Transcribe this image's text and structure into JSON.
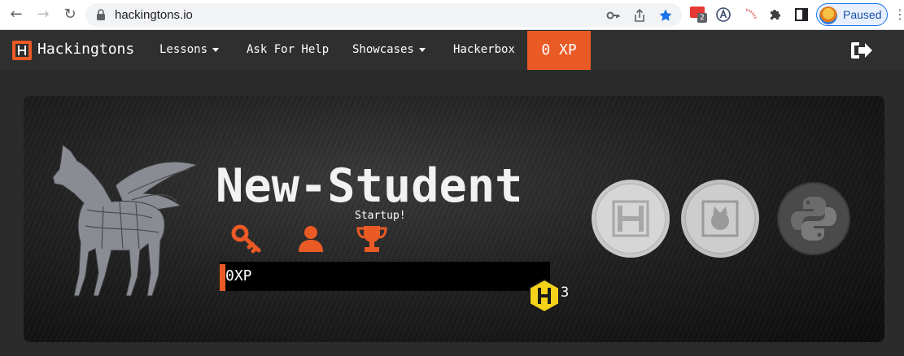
{
  "browser": {
    "url": "hackingtons.io",
    "extension_badge": "2",
    "profile_label": "Paused"
  },
  "nav": {
    "brand": "Hackingtons",
    "items": [
      {
        "label": "Lessons",
        "dropdown": true
      },
      {
        "label": "Ask For Help",
        "dropdown": false
      },
      {
        "label": "Showcases",
        "dropdown": true
      },
      {
        "label": "Hackerbox",
        "dropdown": false
      }
    ],
    "xp_badge": "0 XP"
  },
  "profile": {
    "name": "New-Student",
    "badge_tooltip": "Startup!",
    "badges": [
      "key-icon",
      "user-icon",
      "trophy-icon"
    ],
    "xp_label": "0XP",
    "xp_progress": 0,
    "hex_count": "3",
    "coins": [
      "hackingtons-coin",
      "scratch-coin",
      "python-coin"
    ]
  },
  "colors": {
    "accent": "#ea5a25",
    "hex_badge": "#f4d21a",
    "nav_bg": "#2f2f2f"
  }
}
